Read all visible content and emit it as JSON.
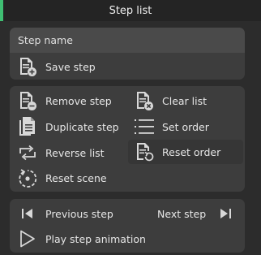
{
  "header": {
    "title": "Step list"
  },
  "step_name": {
    "placeholder": "Step name"
  },
  "buttons": {
    "save_step": "Save step",
    "remove_step": "Remove step",
    "clear_list": "Clear list",
    "duplicate_step": "Duplicate step",
    "set_order": "Set order",
    "reverse_list": "Reverse list",
    "reset_order": "Reset order",
    "reset_scene": "Reset scene",
    "previous_step": "Previous step",
    "next_step": "Next step",
    "play_step_animation": "Play step animation"
  },
  "colors": {
    "accent": "#3fbf73",
    "panel": "#3d3d3d",
    "background": "#2c2c2c"
  },
  "icons": [
    "doc-plus-icon",
    "doc-minus-icon",
    "doc-x-icon",
    "copy-icon",
    "list-icon",
    "reverse-icon",
    "doc-refresh-icon",
    "reset-scene-icon",
    "skip-back-icon",
    "skip-forward-icon",
    "play-icon"
  ]
}
